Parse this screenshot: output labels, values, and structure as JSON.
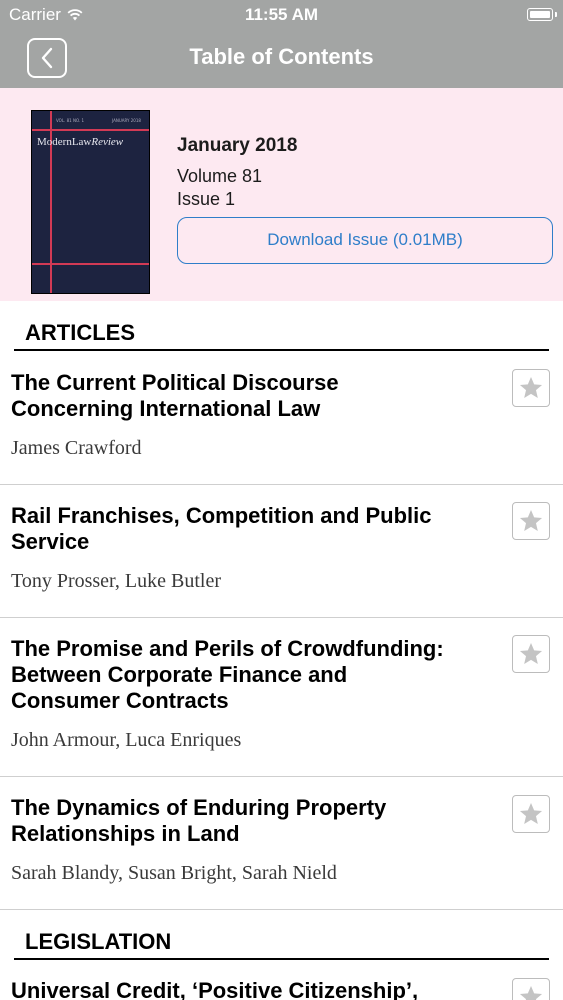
{
  "status_bar": {
    "carrier": "Carrier",
    "time": "11:55 AM"
  },
  "nav": {
    "title": "Table of Contents"
  },
  "issue": {
    "cover_title": "ModernLaw",
    "cover_title_italic": "Review",
    "cover_meta_left": "VOL. 81 NO. 1",
    "cover_meta_right": "JANUARY 2018",
    "date": "January 2018",
    "volume": "Volume 81",
    "number": "Issue 1",
    "download_label": "Download Issue (0.01MB)"
  },
  "sections": [
    {
      "heading": "ARTICLES",
      "articles": [
        {
          "title_lines": [
            "The Current Political Discourse",
            "Concerning International Law"
          ],
          "authors": "James Crawford"
        },
        {
          "title_lines": [
            "Rail Franchises, Competition and Public",
            "Service"
          ],
          "authors": "Tony Prosser, Luke Butler"
        },
        {
          "title_lines": [
            "The Promise and Perils of Crowdfunding:",
            "Between Corporate Finance and",
            "Consumer Contracts"
          ],
          "authors": "John Armour, Luca Enriques"
        },
        {
          "title_lines": [
            "The Dynamics of Enduring Property",
            "Relationships in Land"
          ],
          "authors": "Sarah Blandy, Susan Bright, Sarah Nield"
        }
      ]
    },
    {
      "heading": "LEGISLATION",
      "articles": [
        {
          "title_lines": [
            "Universal Credit, ‘Positive Citizenship’,"
          ],
          "authors": ""
        }
      ]
    }
  ]
}
